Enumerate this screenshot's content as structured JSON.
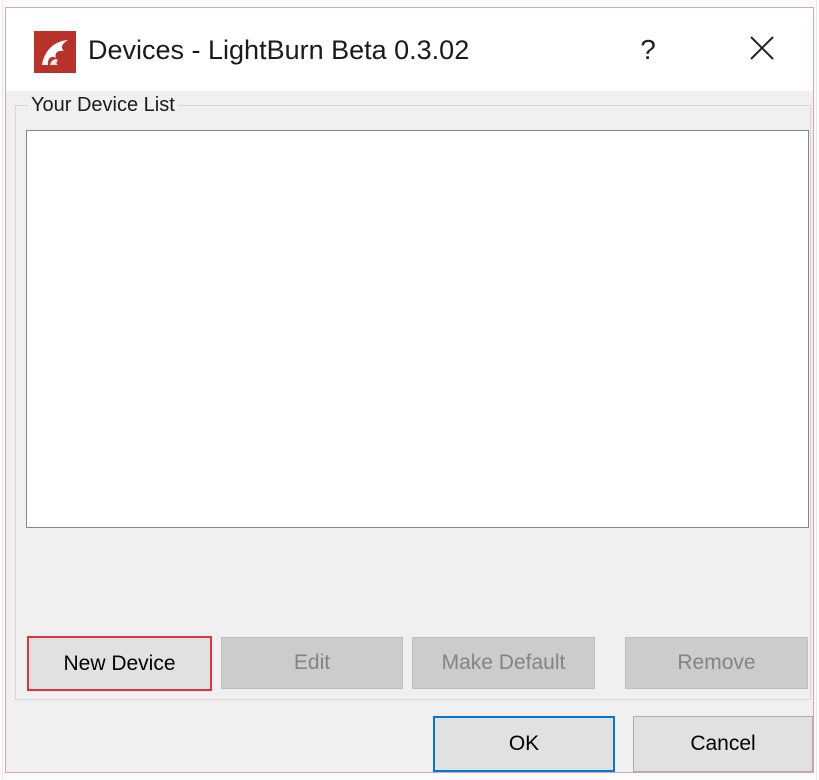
{
  "window": {
    "title": "Devices - LightBurn Beta 0.3.02",
    "help_label": "?",
    "icons": {
      "app": "lightburn-logo-icon",
      "close": "close-icon"
    }
  },
  "device_list": {
    "group_title": "Your Device List",
    "items": []
  },
  "buttons": {
    "new_device": "New Device",
    "edit": "Edit",
    "make_default": "Make Default",
    "remove": "Remove",
    "ok": "OK",
    "cancel": "Cancel"
  },
  "colors": {
    "focus_highlight": "#d9363e",
    "default_button_border": "#0078d7",
    "app_icon_bg": "#c0392b"
  }
}
